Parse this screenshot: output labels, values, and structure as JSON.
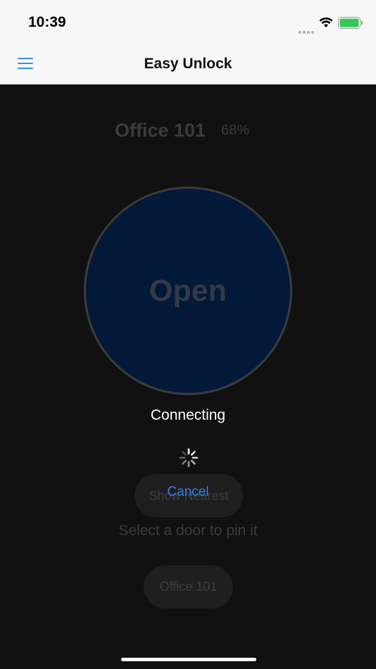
{
  "status": {
    "time": "10:39",
    "battery_color": "#34c759"
  },
  "nav": {
    "title": "Easy Unlock",
    "menu_icon": "hamburger-icon",
    "accent": "#3a8ee6"
  },
  "door": {
    "name": "Office 101",
    "battery": "68%"
  },
  "open_button": {
    "label": "Open",
    "color": "#03193a"
  },
  "show_nearest": {
    "label": "Show Nearest"
  },
  "hint": "Select a door to pin it",
  "door_chips": [
    {
      "label": "Office 101"
    }
  ],
  "overlay": {
    "status": "Connecting",
    "cancel_label": "Cancel"
  }
}
